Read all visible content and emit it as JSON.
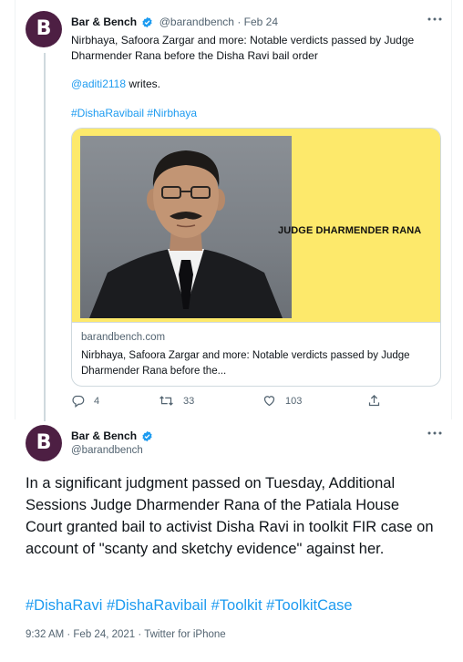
{
  "quoted_tweet": {
    "author_name": "Bar & Bench",
    "handle": "@barandbench",
    "separator": "·",
    "date": "Feb 24",
    "text": "Nirbhaya, Safoora Zargar and more: Notable verdicts passed by Judge Dharmender Rana before the Disha Ravi bail order",
    "mention": "@aditi2118",
    "mention_suffix": " writes.",
    "hashtags": "#DishaRavibail #Nirbhaya",
    "card": {
      "image_caption": "JUDGE DHARMENDER RANA",
      "domain": "barandbench.com",
      "title": "Nirbhaya, Safoora Zargar and more: Notable verdicts passed by Judge Dharmender Rana before the..."
    },
    "actions": {
      "replies": "4",
      "retweets": "33",
      "likes": "103"
    }
  },
  "main_tweet": {
    "author_name": "Bar & Bench",
    "handle": "@barandbench",
    "text": "In a significant judgment passed on Tuesday, Additional Sessions Judge Dharmender Rana of the Patiala House Court granted bail to activist Disha Ravi in toolkit FIR case on account of \"scanty and sketchy evidence\" against her.",
    "hashtags": "#DishaRavi #DishaRavibail #Toolkit #ToolkitCase",
    "footer": "9:32 AM · Feb 24, 2021 · Twitter for iPhone"
  },
  "colors": {
    "link": "#1d9bf0",
    "muted": "#536471",
    "avatar_bg": "#4d1f43",
    "card_bg": "#fde96b"
  },
  "icons": [
    "verified-badge-icon",
    "more-options-icon",
    "reply-icon",
    "retweet-icon",
    "like-icon",
    "share-icon"
  ]
}
